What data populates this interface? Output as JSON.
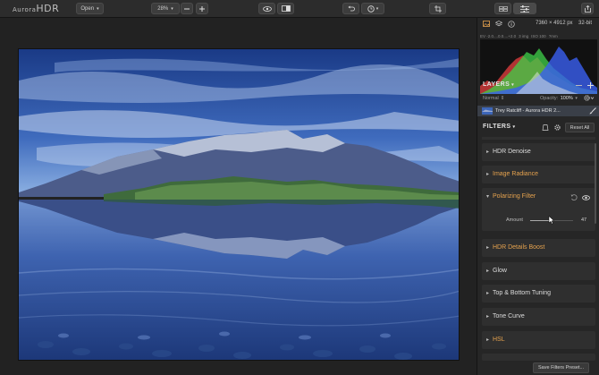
{
  "app": {
    "logo_prefix": "Aurora",
    "logo_suffix": "HDR"
  },
  "toolbar": {
    "open_label": "Open",
    "zoom_value": "28%"
  },
  "image_info": {
    "dimensions": "7360 × 4912 px",
    "bit_depth": "32-bit",
    "exif": [
      "EV -2.0....0.0....+2.0",
      "3 img",
      "ISO 100",
      "?mm"
    ]
  },
  "layers": {
    "title": "LAYERS",
    "blend_mode": "Normal",
    "opacity_label": "Opacity:",
    "opacity_value": "100%",
    "layer_name": "Trey Ratcliff - Aurora HDR 2..."
  },
  "filters": {
    "title": "FILTERS",
    "reset_label": "Reset All",
    "items": [
      {
        "label": "HDR Denoise",
        "color": "#dcdcdc"
      },
      {
        "label": "Image Radiance",
        "color": "#e5a24e"
      },
      {
        "label": "Polarizing Filter",
        "color": "#e5a24e"
      },
      {
        "label": "HDR Details Boost",
        "color": "#e5a24e"
      },
      {
        "label": "Glow",
        "color": "#dcdcdc"
      },
      {
        "label": "Top & Bottom Tuning",
        "color": "#dcdcdc"
      },
      {
        "label": "Tone Curve",
        "color": "#dcdcdc"
      },
      {
        "label": "HSL",
        "color": "#e5a24e"
      }
    ],
    "polarizing_amount_label": "Amount",
    "polarizing_amount_value": "47"
  },
  "footer": {
    "save_preset_label": "Save Filters Preset..."
  },
  "colors": {
    "accent_orange": "#e5a24e",
    "panel_bg": "#262626",
    "layer_highlight": "#3a3f48"
  }
}
